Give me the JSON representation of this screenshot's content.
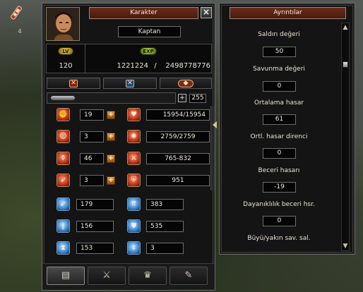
{
  "item_slot": {
    "count": "4"
  },
  "character_window": {
    "title": "Karakter",
    "close_icon": "×",
    "name": "Kaptan",
    "level_badge": "LV",
    "exp_badge": "EXP",
    "level": "120",
    "exp_current": "1221224",
    "exp_separator": "/",
    "exp_max": "2498778776",
    "mode_icons": [
      "✕",
      "✕",
      "◆"
    ],
    "stat_points_plus": "+",
    "stat_points": "255",
    "stats": [
      {
        "icon": "strength-icon",
        "value": "19",
        "plus": "+",
        "derived_icon": "hp-icon",
        "derived": "15954/15954"
      },
      {
        "icon": "vitality-icon",
        "value": "3",
        "plus": "+",
        "derived_icon": "mp-icon",
        "derived": "2759/2759"
      },
      {
        "icon": "intelligence-icon",
        "value": "46",
        "plus": "+",
        "derived_icon": "attack-icon",
        "derived": "765-832"
      },
      {
        "icon": "dexterity-icon",
        "value": "3",
        "plus": "+",
        "derived_icon": "defense-icon",
        "derived": "951"
      }
    ],
    "secondary_stats": [
      {
        "left_icon": "attack-speed-icon",
        "left": "179",
        "right_icon": "move-speed-icon",
        "right": "383"
      },
      {
        "left_icon": "magic-attack-icon",
        "left": "156",
        "right_icon": "magic-defense-icon",
        "right": "535"
      },
      {
        "left_icon": "cast-speed-icon",
        "left": "153",
        "right_icon": "evasion-icon",
        "right": "3"
      }
    ],
    "tabs": [
      {
        "icon": "character-sheet-icon",
        "glyph": "▤"
      },
      {
        "icon": "sword-icon",
        "glyph": "⚔"
      },
      {
        "icon": "emote-icon",
        "glyph": "♛"
      },
      {
        "icon": "quest-icon",
        "glyph": "✎"
      }
    ]
  },
  "details_window": {
    "title": "Ayrıntılar",
    "rows": [
      {
        "label": "Saldırı değeri",
        "value": "50"
      },
      {
        "label": "Savunma değeri",
        "value": "0"
      },
      {
        "label": "Ortalama hasar",
        "value": "61"
      },
      {
        "label": "Ortl. hasar direnci",
        "value": "0"
      },
      {
        "label": "Beceri hasarı",
        "value": "-19"
      },
      {
        "label": "Dayanıklılık beceri hsr.",
        "value": "0"
      },
      {
        "label": "Büyü/yakın sav. sal.",
        "value": ""
      }
    ],
    "scroll_up": "▲",
    "scroll_down": "▼"
  }
}
